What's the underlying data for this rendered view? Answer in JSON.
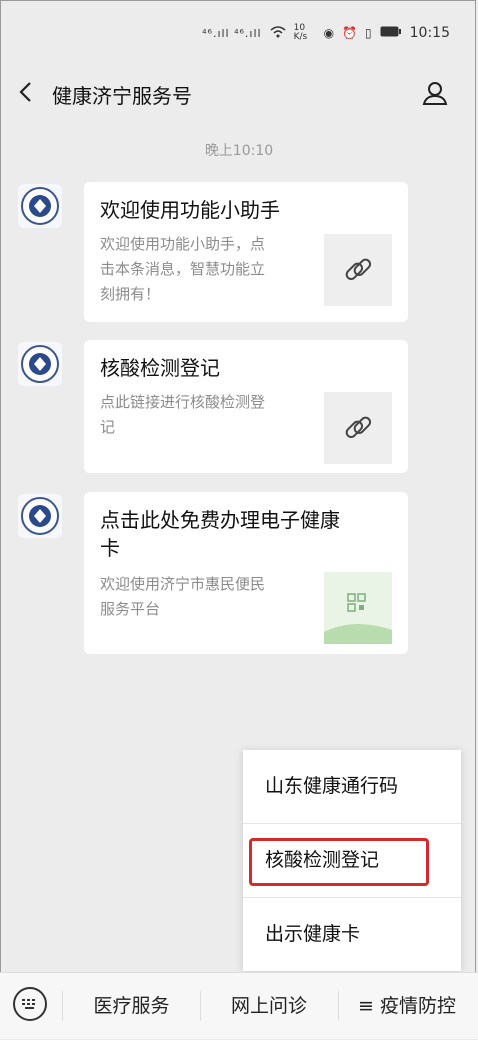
{
  "status_bar": {
    "network": "⁴⁶.ıll ⁴⁶.ıll",
    "speed": "10 K/s",
    "time": "10:15"
  },
  "nav": {
    "title": "健康济宁服务号"
  },
  "timestamp": "晚上10:10",
  "messages": [
    {
      "title": "欢迎使用功能小助手",
      "desc": [
        "欢迎使用功能小助手，点",
        "击本条消息，智慧功能立",
        "刻拥有！"
      ]
    },
    {
      "title": "核酸检测登记",
      "desc": [
        "点此链接进行核酸检测登",
        "记"
      ]
    },
    {
      "title": [
        "点击此处免费办理电子健康",
        "卡"
      ],
      "desc": [
        "欢迎使用济宁市惠民便民",
        "服务平台"
      ]
    }
  ],
  "menu": {
    "items": [
      "山东健康通行码",
      "核酸检测登记",
      "出示健康卡"
    ]
  },
  "bottom_bar": {
    "tabs": [
      "医疗服务",
      "网上问诊",
      "≡ 疫情防控"
    ]
  },
  "colors": {
    "background": "#ececec",
    "highlight": "#d22b2b"
  }
}
